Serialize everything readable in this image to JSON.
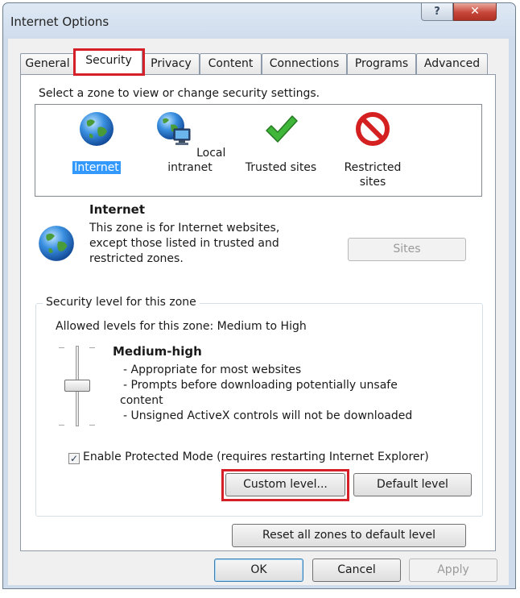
{
  "window": {
    "title": "Internet Options",
    "help_glyph": "?",
    "close_glyph": "✕"
  },
  "tabs": [
    {
      "label": "General",
      "active": false
    },
    {
      "label": "Security",
      "active": true
    },
    {
      "label": "Privacy",
      "active": false
    },
    {
      "label": "Content",
      "active": false
    },
    {
      "label": "Connections",
      "active": false
    },
    {
      "label": "Programs",
      "active": false
    },
    {
      "label": "Advanced",
      "active": false
    }
  ],
  "security": {
    "zone_prompt": "Select a zone to view or change security settings.",
    "zones": [
      {
        "label": "Internet",
        "icon": "globe-icon",
        "selected": true
      },
      {
        "label": "Local intranet",
        "icon": "intranet-icon",
        "selected": false
      },
      {
        "label": "Trusted sites",
        "icon": "checkmark-icon",
        "selected": false
      },
      {
        "label": "Restricted sites",
        "icon": "prohibited-icon",
        "selected": false
      }
    ],
    "selected_zone": {
      "title": "Internet",
      "description": "This zone is for Internet websites, except those listed in trusted and restricted zones.",
      "icon": "globe-icon"
    },
    "sites_button": "Sites",
    "level_group": {
      "legend": "Security level for this zone",
      "allowed": "Allowed levels for this zone: Medium to High",
      "level_name": "Medium-high",
      "bullets": [
        "- Appropriate for most websites",
        "- Prompts before downloading potentially unsafe",
        "content",
        "- Unsigned ActiveX controls will not be downloaded"
      ],
      "protected_mode_label": "Enable Protected Mode (requires restarting Internet Explorer)",
      "protected_mode_checked": true,
      "custom_level_button": "Custom level...",
      "default_level_button": "Default level"
    },
    "reset_all_button": "Reset all zones to default level"
  },
  "footer": {
    "ok": "OK",
    "cancel": "Cancel",
    "apply": "Apply"
  },
  "colors": {
    "highlight_box": "#d5202a",
    "selection": "#3399ff",
    "close_button": "#c7463a"
  }
}
